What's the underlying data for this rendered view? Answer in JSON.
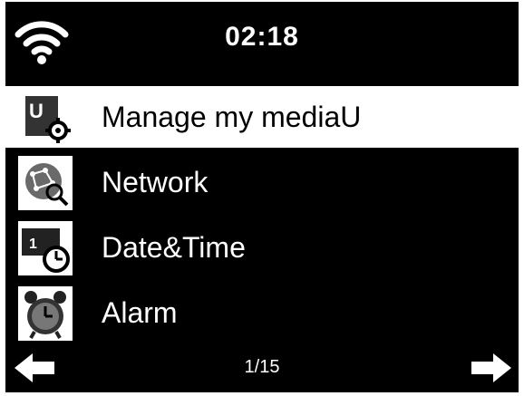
{
  "status": {
    "time": "02:18",
    "wifi_icon": "wifi-icon"
  },
  "menu": {
    "items": [
      {
        "label": "Manage my mediaU",
        "icon": "mediau-settings-icon",
        "selected": true
      },
      {
        "label": "Network",
        "icon": "network-icon",
        "selected": false
      },
      {
        "label": "Date&Time",
        "icon": "calendar-clock-icon",
        "selected": false
      },
      {
        "label": "Alarm",
        "icon": "alarm-clock-icon",
        "selected": false
      }
    ]
  },
  "footer": {
    "page": "1/15",
    "prev_icon": "arrow-left-icon",
    "next_icon": "arrow-right-icon"
  },
  "colors": {
    "background": "#000000",
    "selected_background": "#ffffff",
    "text": "#ffffff",
    "selected_text": "#000000"
  }
}
